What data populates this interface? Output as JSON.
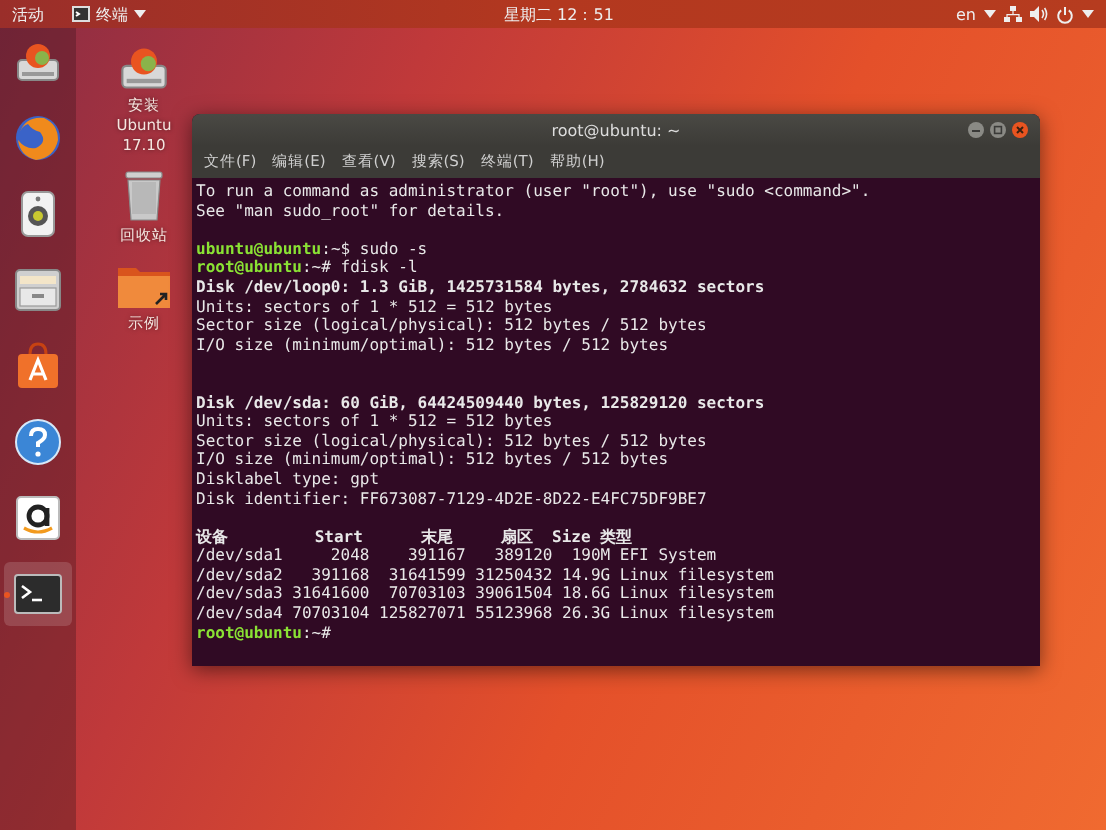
{
  "top_bar": {
    "activities": "活动",
    "app_menu": "终端",
    "clock": "星期二 12：51",
    "language": "en"
  },
  "dock": [
    {
      "kind": "installer",
      "selected": false
    },
    {
      "kind": "browser",
      "selected": false
    },
    {
      "kind": "music",
      "selected": false
    },
    {
      "kind": "files",
      "selected": false
    },
    {
      "kind": "software",
      "selected": false
    },
    {
      "kind": "help",
      "selected": false
    },
    {
      "kind": "amazon",
      "selected": false
    },
    {
      "kind": "terminal",
      "selected": true
    }
  ],
  "desktop_icons": [
    {
      "kind": "installer",
      "label": "安装 Ubuntu 17.10"
    },
    {
      "kind": "trash",
      "label": "回收站"
    },
    {
      "kind": "folder",
      "label": "示例"
    }
  ],
  "terminal": {
    "title": "root@ubuntu: ~",
    "menu": [
      "文件(F)",
      "编辑(E)",
      "查看(V)",
      "搜索(S)",
      "终端(T)",
      "帮助(H)"
    ],
    "lines": [
      {
        "kind": "output",
        "text": "To run a command as administrator (user \"root\"), use \"sudo <command>\"."
      },
      {
        "kind": "output",
        "text": "See \"man sudo_root\" for details."
      },
      {
        "kind": "blank"
      },
      {
        "kind": "prompt",
        "user": "ubuntu@ubuntu",
        "rest": ":~$ sudo -s"
      },
      {
        "kind": "prompt",
        "user": "root@ubuntu",
        "rest": ":~# fdisk -l"
      },
      {
        "kind": "bold",
        "text": "Disk /dev/loop0: 1.3 GiB, 1425731584 bytes, 2784632 sectors"
      },
      {
        "kind": "output",
        "text": "Units: sectors of 1 * 512 = 512 bytes"
      },
      {
        "kind": "output",
        "text": "Sector size (logical/physical): 512 bytes / 512 bytes"
      },
      {
        "kind": "output",
        "text": "I/O size (minimum/optimal): 512 bytes / 512 bytes"
      },
      {
        "kind": "blank"
      },
      {
        "kind": "blank"
      },
      {
        "kind": "bold",
        "text": "Disk /dev/sda: 60 GiB, 64424509440 bytes, 125829120 sectors"
      },
      {
        "kind": "output",
        "text": "Units: sectors of 1 * 512 = 512 bytes"
      },
      {
        "kind": "output",
        "text": "Sector size (logical/physical): 512 bytes / 512 bytes"
      },
      {
        "kind": "output",
        "text": "I/O size (minimum/optimal): 512 bytes / 512 bytes"
      },
      {
        "kind": "output",
        "text": "Disklabel type: gpt"
      },
      {
        "kind": "output",
        "text": "Disk identifier: FF673087-7129-4D2E-8D22-E4FC75DF9BE7"
      },
      {
        "kind": "blank"
      },
      {
        "kind": "bold",
        "text": "设备         Start      末尾     扇区  Size 类型"
      },
      {
        "kind": "output",
        "text": "/dev/sda1     2048    391167   389120  190M EFI System"
      },
      {
        "kind": "output",
        "text": "/dev/sda2   391168  31641599 31250432 14.9G Linux filesystem"
      },
      {
        "kind": "output",
        "text": "/dev/sda3 31641600  70703103 39061504 18.6G Linux filesystem"
      },
      {
        "kind": "output",
        "text": "/dev/sda4 70703104 125827071 55123968 26.3G Linux filesystem"
      },
      {
        "kind": "prompt",
        "user": "root@ubuntu",
        "rest": ":~#"
      }
    ]
  }
}
